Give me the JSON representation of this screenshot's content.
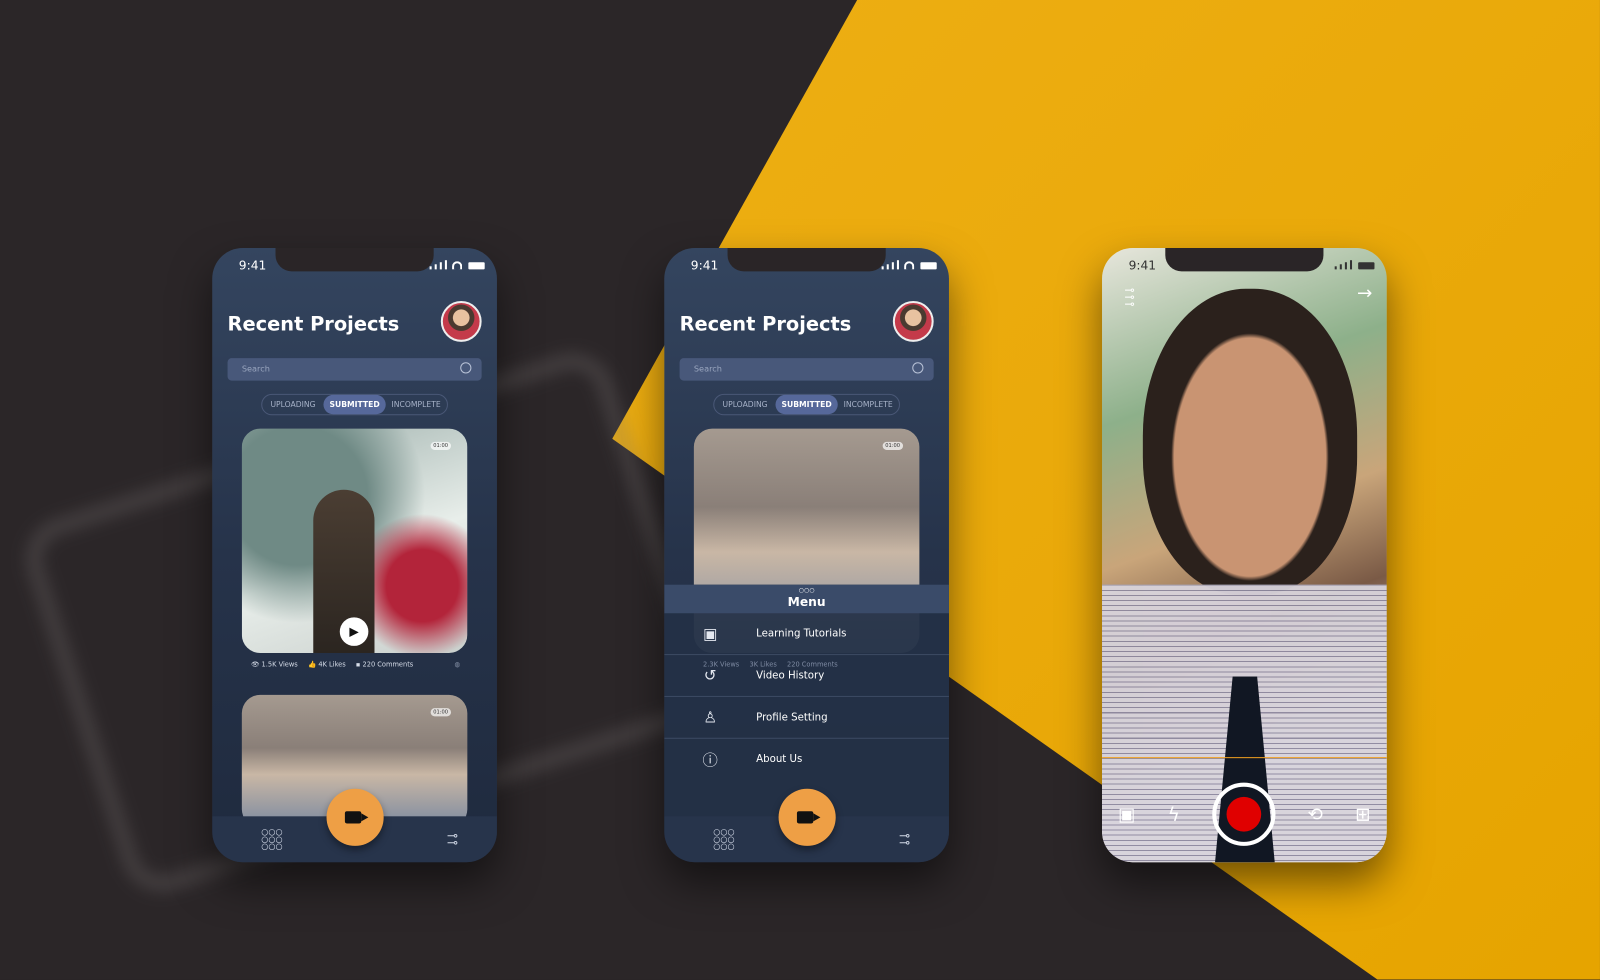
{
  "status": {
    "time": "9:41"
  },
  "screen1": {
    "title": "Recent Projects",
    "search_placeholder": "Search",
    "tabs": [
      "UPLOADING",
      "SUBMITTED",
      "INCOMPLETE"
    ],
    "active_tab": "SUBMITTED",
    "cards": [
      {
        "duration": "01:00",
        "views": "1.5K Views",
        "likes": "4K Likes",
        "comments": "220 Comments"
      },
      {
        "duration": "01:00"
      }
    ]
  },
  "screen2": {
    "title": "Recent Projects",
    "search_placeholder": "Search",
    "tabs": [
      "UPLOADING",
      "SUBMITTED",
      "INCOMPLETE"
    ],
    "card_duration": "01:00",
    "hidden_stats": {
      "views": "2.3K Views",
      "likes": "3K Likes",
      "comments": "220 Comments"
    },
    "menu": {
      "title": "Menu",
      "items": [
        {
          "label": "Learning Tutorials",
          "icon": "video-tutorial-icon"
        },
        {
          "label": "Video History",
          "icon": "history-icon"
        },
        {
          "label": "Profile Setting",
          "icon": "user-icon"
        },
        {
          "label": "About Us",
          "icon": "info-icon"
        }
      ]
    }
  },
  "screen3": {
    "record_color": "#e00000"
  },
  "colors": {
    "accent": "#ee9f45",
    "background_yellow": "#e6a400",
    "panel": "#26334a"
  }
}
